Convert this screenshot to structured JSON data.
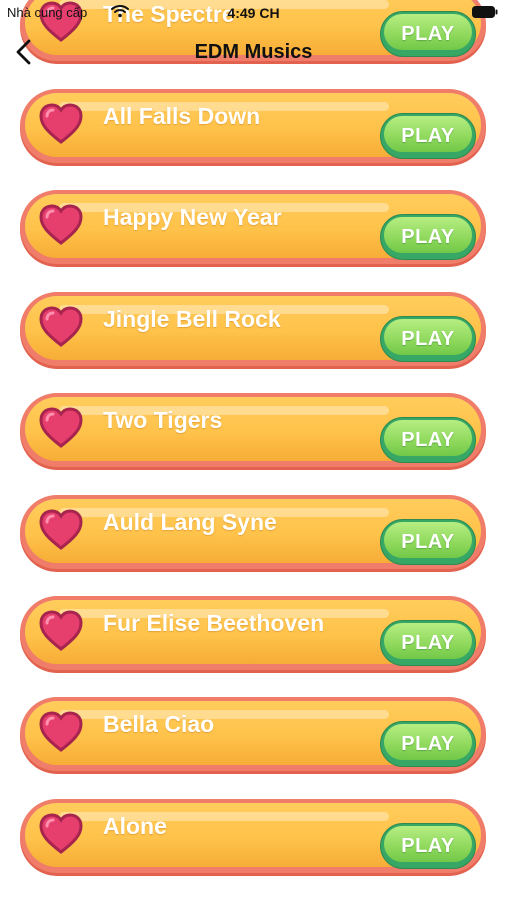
{
  "status_bar": {
    "carrier": "Nhà cung cấp",
    "time": "4:49 CH",
    "wifi_icon": "wifi-icon",
    "battery_icon": "battery-icon"
  },
  "nav": {
    "back_icon": "chevron-left-icon",
    "title": "EDM Musics"
  },
  "songs": [
    {
      "title": "The Spectre",
      "play_label": "PLAY"
    },
    {
      "title": "All Falls Down",
      "play_label": "PLAY"
    },
    {
      "title": "Happy New Year",
      "play_label": "PLAY"
    },
    {
      "title": "Jingle Bell Rock",
      "play_label": "PLAY"
    },
    {
      "title": "Two Tigers",
      "play_label": "PLAY"
    },
    {
      "title": "Auld Lang Syne",
      "play_label": "PLAY"
    },
    {
      "title": "Fur Elise Beethoven",
      "play_label": "PLAY"
    },
    {
      "title": "Bella Ciao",
      "play_label": "PLAY"
    },
    {
      "title": "Alone",
      "play_label": "PLAY"
    }
  ],
  "colors": {
    "pill_border": "#ef7d6a",
    "pill_fill": "#ffc24a",
    "heart": "#e63e6d",
    "play_button": "#8ed85c"
  }
}
